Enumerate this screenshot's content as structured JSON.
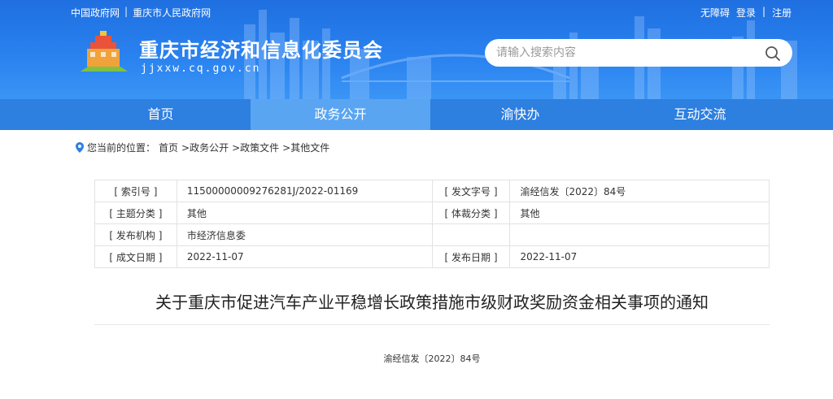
{
  "top_links": {
    "gov_cn": "中国政府网",
    "separator": "|",
    "cq_gov": "重庆市人民政府网"
  },
  "user_links": {
    "accessibility": "无障碍",
    "login": "登录",
    "separator": "|",
    "register": "注册"
  },
  "site": {
    "title": "重庆市经济和信息化委员会",
    "domain": "jjxxw.cq.gov.cn"
  },
  "search": {
    "placeholder": "请输入搜索内容",
    "value": ""
  },
  "nav": {
    "items": [
      {
        "label": "首页",
        "active": false
      },
      {
        "label": "政务公开",
        "active": true
      },
      {
        "label": "渝快办",
        "active": false
      },
      {
        "label": "互动交流",
        "active": false
      }
    ]
  },
  "breadcrumb": {
    "prefix": "您当前的位置：",
    "items": [
      "首页",
      ">政务公开",
      ">政策文件",
      ">其他文件"
    ]
  },
  "meta_table": {
    "rows": [
      {
        "k1": "[ 索引号 ]",
        "v1": "11500000009276281J/2022-01169",
        "k2": "[ 发文字号 ]",
        "v2": "渝经信发〔2022〕84号"
      },
      {
        "k1": "[ 主题分类 ]",
        "v1": "其他",
        "k2": "[ 体裁分类 ]",
        "v2": "其他"
      },
      {
        "k1": "[ 发布机构 ]",
        "v1": "市经济信息委",
        "k2": "",
        "v2": ""
      },
      {
        "k1": "[ 成文日期 ]",
        "v1": "2022-11-07",
        "k2": "[ 发布日期 ]",
        "v2": "2022-11-07"
      }
    ]
  },
  "document": {
    "title": "关于重庆市促进汽车产业平稳增长政策措施市级财政奖励资金相关事项的通知",
    "number": "渝经信发〔2022〕84号"
  },
  "colors": {
    "header_blue": "#2a83f0",
    "nav_blue": "#2d7fe0",
    "nav_active": "#5aa5f2"
  }
}
